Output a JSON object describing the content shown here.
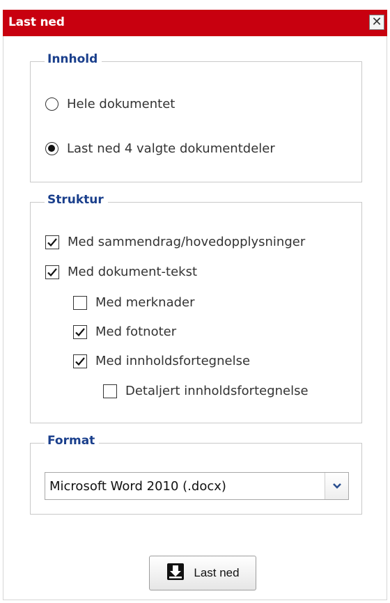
{
  "dialog": {
    "title": "Last ned",
    "close_glyph": "✕",
    "title_bar_color": "#c8000f"
  },
  "content_section": {
    "legend": "Innhold",
    "options": [
      {
        "label": "Hele dokumentet",
        "selected": false
      },
      {
        "label": "Last ned 4 valgte dokumentdeler",
        "selected": true
      }
    ]
  },
  "structure_section": {
    "legend": "Struktur",
    "items": [
      {
        "label": "Med sammendrag/hovedopplysninger",
        "checked": true
      },
      {
        "label": "Med dokument-tekst",
        "checked": true
      },
      {
        "label": "Med merknader",
        "checked": false
      },
      {
        "label": "Med fotnoter",
        "checked": true
      },
      {
        "label": "Med innholdsfortegnelse",
        "checked": true
      },
      {
        "label": "Detaljert innholdsfortegnelse",
        "checked": false
      }
    ]
  },
  "format_section": {
    "legend": "Format",
    "selected_value": "Microsoft Word 2010 (.docx)",
    "arrow_icon": "chevron-down-icon"
  },
  "download_button": {
    "label": "Last ned",
    "icon": "download-tray-icon"
  }
}
